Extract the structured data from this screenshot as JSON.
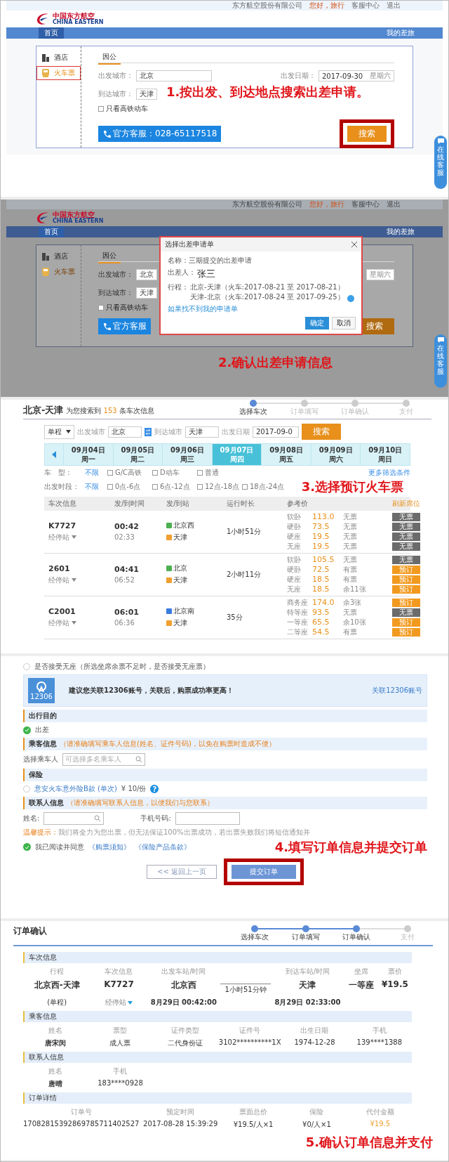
{
  "step1": {
    "topbar": {
      "company": "东方航空股份有限公司",
      "greeting": "您好，旅行",
      "service": "客服中心",
      "logout": "退出"
    },
    "logo": {
      "cn": "中国东方航空",
      "en": "CHINA EASTERN"
    },
    "nav": {
      "home": "首页",
      "right": "我的差旅"
    },
    "sidebar": [
      {
        "label": "酒店",
        "kind": "hotel",
        "selected": false
      },
      {
        "label": "火车票",
        "kind": "train",
        "selected": true
      }
    ],
    "tab": "因公",
    "from": {
      "label": "出发城市：",
      "value": "北京"
    },
    "date": {
      "label": "出发日期：",
      "value": "2017-09-30",
      "weekday": "星期六"
    },
    "to": {
      "label": "到达城市：",
      "value": "天津"
    },
    "option": {
      "label": "只看高铁动车",
      "checked": false
    },
    "hotline": "官方客服：028-65117518",
    "search_button": "搜索",
    "side_widget": "在线客服",
    "annotation": "1.按出发、到达地点搜索出差申请。"
  },
  "step2": {
    "topbar": {
      "company": "东方航空股份有限公司",
      "greeting": "您好，旅行",
      "service": "客服中心",
      "logout": "退出"
    },
    "logo": {
      "cn": "中国东方航空",
      "en": "CHINA EASTERN"
    },
    "nav": {
      "home": "首页",
      "right": "我的差旅"
    },
    "sidebar": [
      {
        "label": "酒店",
        "kind": "hotel",
        "selected": false
      },
      {
        "label": "火车票",
        "kind": "train",
        "selected": true
      }
    ],
    "tab": "因公",
    "from": {
      "label": "出发城市：",
      "value": "北京"
    },
    "date": {
      "weekday": "星期六"
    },
    "to": {
      "label": "到达城市：",
      "value": "天津"
    },
    "option": {
      "label": "只看高铁动车",
      "checked": false
    },
    "hotline": "官方客服",
    "search_button": "搜索",
    "side_widget": "在线客服",
    "dialog": {
      "title": "选择出差申请单",
      "name": "名称：三期提交的出差申请",
      "traveler_label": "出差人：",
      "traveler": "张三",
      "trip_label": "行程：",
      "trips": [
        "北京-天津（火车:2017-08-21 至 2017-08-21）",
        "天津-北京（火车:2017-08-24 至 2017-09-25）"
      ],
      "selected": true,
      "link": "如果找不到我的申请单",
      "ok": "确定",
      "cancel": "取消"
    },
    "annotation": "2.确认出差申请信息"
  },
  "step3": {
    "route": "北京-天津",
    "summary": "为您搜索到 **153** 条车次信息",
    "steps": [
      {
        "label": "选择车次",
        "done": true
      },
      {
        "label": "订单填写",
        "done": false
      },
      {
        "label": "订单确认",
        "done": false
      },
      {
        "label": "支付",
        "done": false
      }
    ],
    "trip_type": "单程",
    "from": {
      "label": "出发城市",
      "value": "北京"
    },
    "to": {
      "label": "到达城市",
      "value": "天津"
    },
    "date": {
      "label": "出发日期",
      "value": "2017-09-0"
    },
    "search_button": "搜索",
    "dates": [
      {
        "date": "09月04日",
        "weekday": "周一",
        "selected": false
      },
      {
        "date": "09月05日",
        "weekday": "周二",
        "selected": false
      },
      {
        "date": "09月06日",
        "weekday": "周三",
        "selected": false
      },
      {
        "date": "09月07日",
        "weekday": "周四",
        "selected": true
      },
      {
        "date": "09月08日",
        "weekday": "周五",
        "selected": false
      },
      {
        "date": "09月09日",
        "weekday": "周六",
        "selected": false
      },
      {
        "date": "09月10日",
        "weekday": "周日",
        "selected": false
      }
    ],
    "filters": [
      {
        "label": "车　型：",
        "any": "不限",
        "options": [
          {
            "label": "G/C高铁",
            "checked": false
          },
          {
            "label": "D动车",
            "checked": false
          },
          {
            "label": "普通",
            "checked": false
          }
        ]
      },
      {
        "label": "出发时段：",
        "any": "不限",
        "options": [
          {
            "label": "0点-6点",
            "checked": false
          },
          {
            "label": "6点-12点",
            "checked": false
          },
          {
            "label": "12点-18点",
            "checked": false
          },
          {
            "label": "18点-24点",
            "checked": false
          }
        ]
      }
    ],
    "more_filters": "更多筛选条件",
    "columns": [
      "车次信息",
      "发/到时间",
      "发/到站",
      "运行时长",
      "参考价",
      "刷新席位"
    ],
    "trains": [
      {
        "number": "K7727",
        "stops": "经停站",
        "depart": "00:42",
        "arrive": "02:33",
        "from": {
          "station": "北京西",
          "kind": "pass"
        },
        "to": {
          "station": "天津",
          "kind": "end"
        },
        "duration": "1小时51分",
        "seats": [
          {
            "class": "软卧",
            "price": "113.0",
            "stock": "无票",
            "action": "无票",
            "available": false
          },
          {
            "class": "硬卧",
            "price": "73.5",
            "stock": "无票",
            "action": "无票",
            "available": false
          },
          {
            "class": "硬座",
            "price": "19.5",
            "stock": "无票",
            "action": "无票",
            "available": false
          },
          {
            "class": "无座",
            "price": "19.5",
            "stock": "无票",
            "action": "无票",
            "available": false
          }
        ]
      },
      {
        "number": "2601",
        "stops": "经停站",
        "depart": "04:41",
        "arrive": "06:52",
        "from": {
          "station": "北京",
          "kind": "pass"
        },
        "to": {
          "station": "天津",
          "kind": "end"
        },
        "duration": "2小时11分",
        "seats": [
          {
            "class": "软卧",
            "price": "105.5",
            "stock": "无票",
            "action": "无票",
            "available": false
          },
          {
            "class": "硬卧",
            "price": "72.5",
            "stock": "有票",
            "action": "预订",
            "available": true
          },
          {
            "class": "硬座",
            "price": "18.5",
            "stock": "有票",
            "action": "预订",
            "available": true
          },
          {
            "class": "无座",
            "price": "18.5",
            "stock": "余11张",
            "action": "预订",
            "available": true
          }
        ]
      },
      {
        "number": "C2001",
        "stops": "经停站",
        "depart": "06:01",
        "arrive": "06:36",
        "from": {
          "station": "北京南",
          "kind": "start"
        },
        "to": {
          "station": "天津",
          "kind": "end"
        },
        "duration": "35分",
        "seats": [
          {
            "class": "商务座",
            "price": "174.0",
            "stock": "余3张",
            "action": "预订",
            "available": true
          },
          {
            "class": "特等座",
            "price": "93.5",
            "stock": "无票",
            "action": "无票",
            "available": false
          },
          {
            "class": "一等座",
            "price": "65.5",
            "stock": "余10张",
            "action": "预订",
            "available": true
          },
          {
            "class": "二等座",
            "price": "54.5",
            "stock": "有票",
            "action": "预订",
            "available": true
          }
        ]
      }
    ],
    "annotation": "3.选择预订火车票"
  },
  "step4": {
    "no_seat": {
      "label": "是否接受无座（所选坐席余票不足时，是否接受无座票）",
      "selected": false
    },
    "banner": {
      "badge": "12306",
      "text": "建议您关联12306账号，关联后，购票成功率更高！",
      "link": "关联12306账号"
    },
    "purpose": {
      "title": "出行目的",
      "option": "出差",
      "checked": true
    },
    "passenger": {
      "title": "乘客信息",
      "hint": "（请准确填写乘车人信息(姓名、证件号码)，以免在购票时造成不便）",
      "label": "选择乘车人",
      "placeholder": "可选择多名乘车人"
    },
    "insurance": {
      "title": "保险",
      "product": "意安火车意外险B款 (单次)",
      "price": "¥ 10/份",
      "help": "?",
      "selected": false
    },
    "contact": {
      "title": "联系人信息",
      "hint": "（请准确填写联系人信息，以便我们与您联系）",
      "name_label": "姓名:",
      "phone_label": "手机号码:"
    },
    "tip_label": "温馨提示：",
    "tip": "我们将全力为您出票，但无法保证100%出票成功，若出票失败我们将短信通知并",
    "agree": {
      "text": "我已阅读并同意",
      "checked": true,
      "links": [
        "《购票须知》",
        "《保险产品条款》"
      ]
    },
    "back_button": "<< 返回上一页",
    "submit_button": "提交订单",
    "annotation": "4.填写订单信息并提交订单"
  },
  "step5": {
    "title": "订单确认",
    "steps": [
      {
        "label": "选择车次",
        "done": true
      },
      {
        "label": "订单填写",
        "done": true
      },
      {
        "label": "订单确认",
        "done": true
      },
      {
        "label": "支付",
        "done": false
      }
    ],
    "train": {
      "title": "车次信息",
      "headers": [
        "行程",
        "车次信息",
        "出发车站/时间",
        "到达车站/时间",
        "坐席",
        "票价"
      ],
      "route": "北京西-天津",
      "trip_type": "(单程)",
      "number": "K7727",
      "stops": "经停站",
      "from": "北京西",
      "from_time": "8月29日 00:42:00",
      "duration": "1小时51分钟",
      "to": "天津",
      "to_time": "8月29日 02:33:00",
      "seat": "一等座",
      "price": "¥19.5"
    },
    "passengers": {
      "title": "乘客信息",
      "headers": [
        "姓名",
        "票型",
        "证件类型",
        "证件号",
        "出生日期",
        "手机"
      ],
      "values": [
        "唐宋闵",
        "成人票",
        "二代身份证",
        "3102**********1X",
        "1974-12-28",
        "139****1388"
      ]
    },
    "contact": {
      "title": "联系人信息",
      "headers": [
        "姓名",
        "手机"
      ],
      "values": [
        "唐晴",
        "183****0928"
      ]
    },
    "order": {
      "title": "订单详情",
      "headers": [
        "订单号",
        "预定时间",
        "票面总价",
        "保险",
        "代付金额"
      ],
      "values": [
        "17082815392869785711402527",
        "2017-08-28 15:39:29",
        "¥19.5/人×1",
        "¥0/人×1",
        "¥19.5"
      ]
    },
    "annotation": "5.确认订单信息并支付"
  }
}
